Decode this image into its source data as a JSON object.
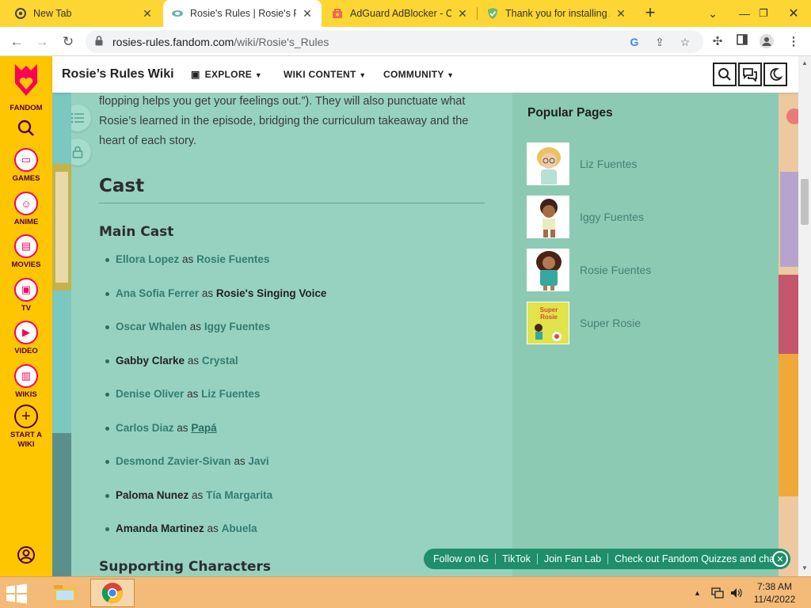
{
  "browser": {
    "tabs": [
      {
        "title": "New Tab",
        "icon": "chrome-icon"
      },
      {
        "title": "Rosie's Rules | Rosie's Rul",
        "icon": "fandom-wiki-icon"
      },
      {
        "title": "AdGuard AdBlocker - Ch",
        "icon": "webstore-icon"
      },
      {
        "title": "Thank you for installing A",
        "icon": "adguard-shield-icon"
      }
    ],
    "url_host": "rosies-rules.fandom.com",
    "url_path": "/wiki/Rosie's_Rules"
  },
  "fandom_rail": {
    "brand": "FANDOM",
    "items": [
      "GAMES",
      "ANIME",
      "MOVIES",
      "TV",
      "VIDEO",
      "WIKIS",
      "START A WIKI"
    ]
  },
  "wiki_header": {
    "title": "Rosie’s Rules Wiki",
    "nav": [
      "EXPLORE",
      "WIKI CONTENT",
      "COMMUNITY"
    ]
  },
  "article": {
    "intro": "flopping helps you get your feelings out.”). They will also punctuate what Rosie’s learned in the episode, bridging the curriculum takeaway and the heart of each story.",
    "heading_cast": "Cast",
    "heading_main_cast": "Main Cast",
    "as_word": "as",
    "main_cast": [
      {
        "actor": "Ellora Lopez",
        "role": "Rosie Fuentes"
      },
      {
        "actor": "Ana Sofia Ferrer",
        "role": "Rosie's Singing Voice"
      },
      {
        "actor": "Oscar Whalen",
        "role": "Iggy Fuentes"
      },
      {
        "actor": "Gabby Clarke",
        "role": "Crystal"
      },
      {
        "actor": "Denise Oliver",
        "role": "Liz Fuentes"
      },
      {
        "actor": "Carlos Diaz",
        "role": "Papá"
      },
      {
        "actor": "Desmond Zavier-Sivan",
        "role": "Javi"
      },
      {
        "actor": "Paloma Nunez",
        "role": "Tía Margarita"
      },
      {
        "actor": "Amanda Martinez",
        "role": "Abuela"
      }
    ],
    "heading_supporting": "Supporting Characters"
  },
  "popular_pages": {
    "title": "Popular Pages",
    "items": [
      "Liz Fuentes",
      "Iggy Fuentes",
      "Rosie Fuentes",
      "Super Rosie"
    ],
    "super_rosie_thumb_text": [
      "Super",
      "Rosie"
    ]
  },
  "social_bar": {
    "items": [
      "Follow on IG",
      "TikTok",
      "Join Fan Lab",
      "Check out Fandom Quizzes and cha"
    ]
  },
  "taskbar": {
    "time": "7:38 AM",
    "date": "11/4/2022"
  },
  "colors": {
    "fandom_yellow": "#fdc600",
    "fandom_pink": "#fa005a",
    "article_bg": "#97d2c0",
    "link": "#347c72",
    "social_green": "#1f8e6a"
  }
}
